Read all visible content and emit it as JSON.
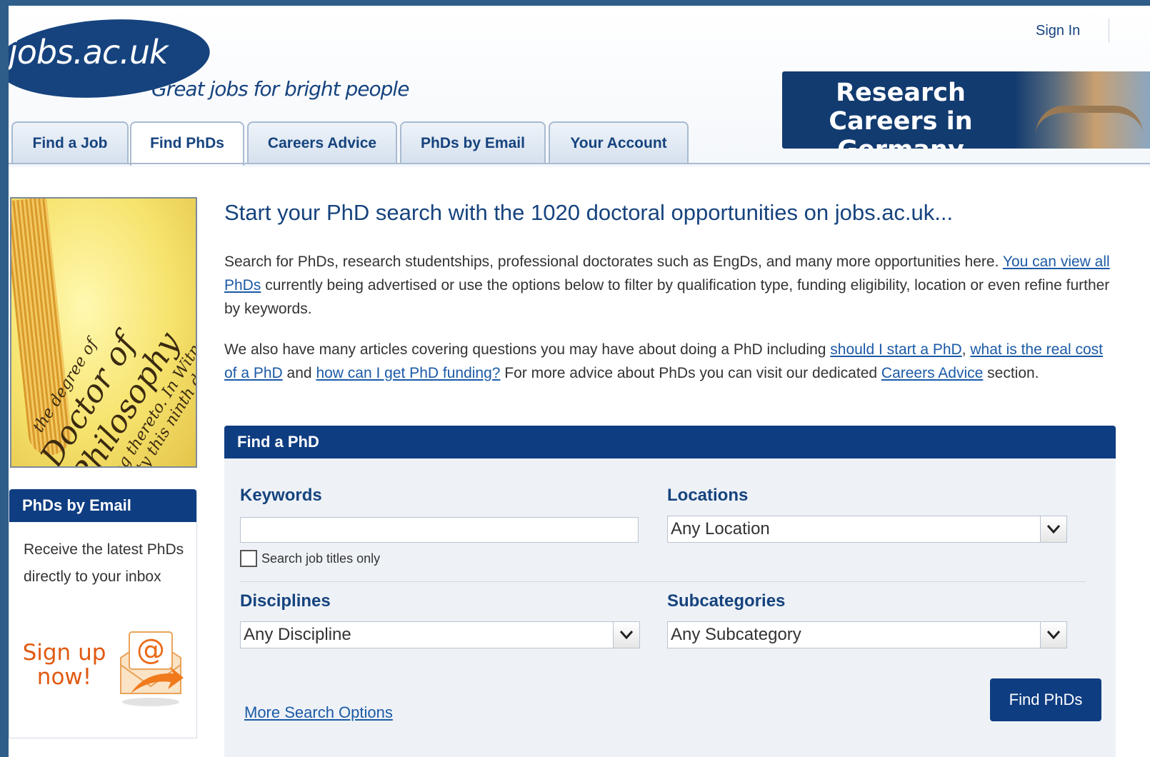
{
  "header": {
    "logo_text": "jobs.ac.uk",
    "tagline": "Great jobs for bright people",
    "sign_in": "Sign In",
    "banner_text": "Research Careers in Germany"
  },
  "tabs": [
    {
      "label": "Find a Job"
    },
    {
      "label": "Find PhDs",
      "active": true
    },
    {
      "label": "Careers Advice"
    },
    {
      "label": "PhDs by Email"
    },
    {
      "label": "Your Account"
    }
  ],
  "sidebar": {
    "image_text": [
      "Doctor of Philosophy",
      "the degree of",
      "ing thereto. In Witness Wh",
      "rsity this ninth day"
    ],
    "box_title": "PhDs by Email",
    "box_text": "Receive the latest PhDs directly to your inbox",
    "signup_line1": "Sign up",
    "signup_line2": "now!"
  },
  "main": {
    "title": "Start your PhD search with the 1020 doctoral opportunities on jobs.ac.uk...",
    "p1_text1": "Search for PhDs, research studentships, professional doctorates such as EngDs, and many more opportunities here. ",
    "p1_link": "You can view all PhDs",
    "p1_text2": " currently being advertised or use the options below to filter by qualification type, funding eligibility, location or even refine further by keywords.",
    "p2_text1": "We also have many articles covering questions you may have about doing a PhD including ",
    "p2_link1": "should I start a PhD",
    "p2_text2": ", ",
    "p2_link2": "what is the real cost of a PhD",
    "p2_text3": " and ",
    "p2_link3": "how can I get PhD funding?",
    "p2_text4": " For more advice about PhDs you can visit our dedicated ",
    "p2_link4": "Careers Advice",
    "p2_text5": " section."
  },
  "search": {
    "heading": "Find a PhD",
    "keywords_label": "Keywords",
    "keywords_value": "",
    "titles_only_label": "Search job titles only",
    "titles_only_checked": false,
    "locations_label": "Locations",
    "locations_value": "Any Location",
    "disciplines_label": "Disciplines",
    "disciplines_value": "Any Discipline",
    "subcategories_label": "Subcategories",
    "subcategories_value": "Any Subcategory",
    "more_options": "More Search Options",
    "submit": "Find PhDs"
  },
  "colors": {
    "brand_blue": "#0f3d82",
    "link_blue": "#1b5aa6",
    "signup_orange": "#e05a12"
  }
}
